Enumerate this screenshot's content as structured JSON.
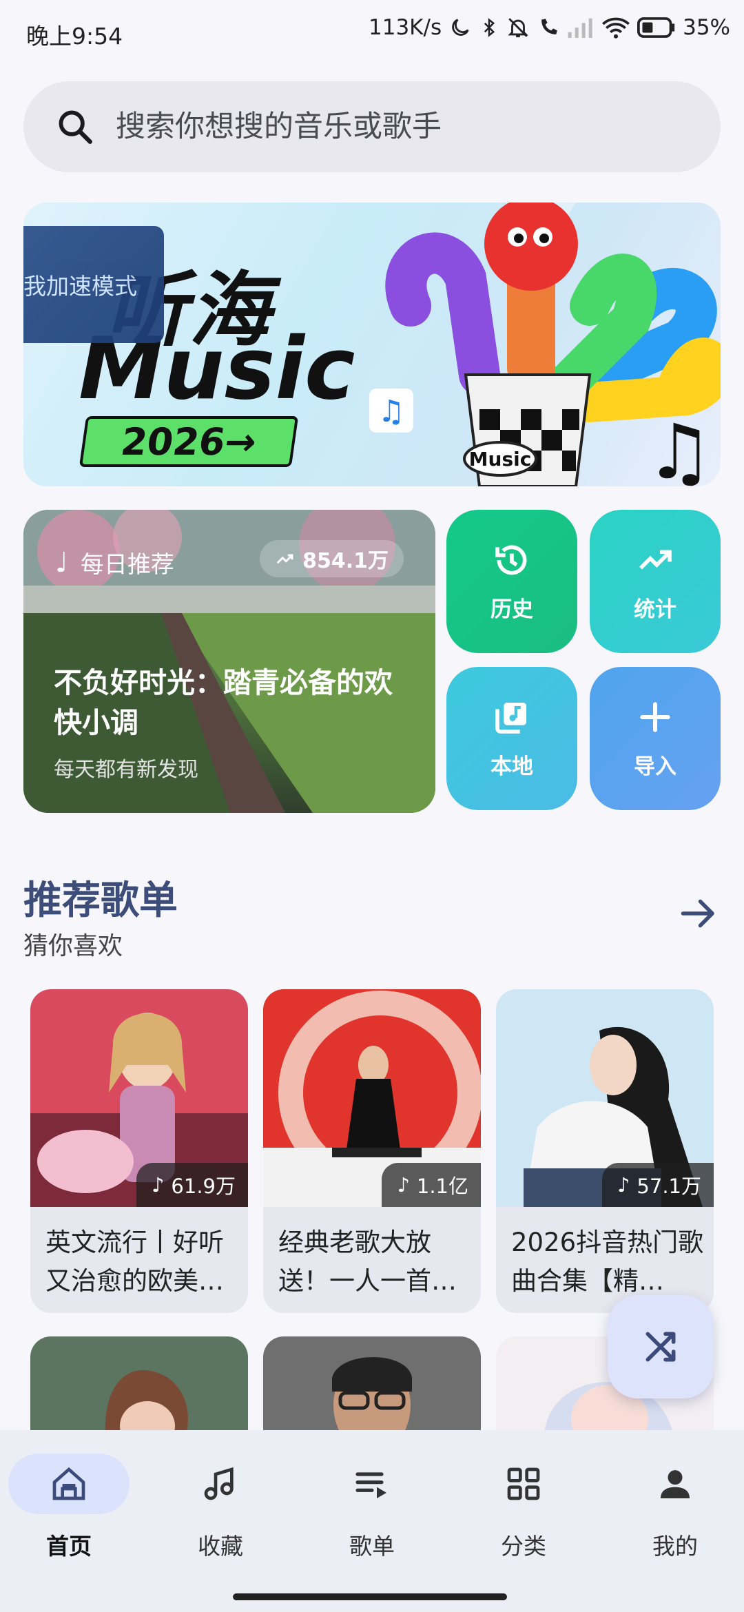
{
  "status_bar": {
    "time": "晚上9:54",
    "speed": "113K/s",
    "battery": "35%"
  },
  "search": {
    "placeholder": "搜索你想搜的音乐或歌手"
  },
  "banner": {
    "logo_line1": "听海",
    "logo_line2": "Music",
    "year_label": "2026→",
    "overlay_text": "我加速模式",
    "cup_text": "Music"
  },
  "daily": {
    "tag": "每日推荐",
    "play_count": "854.1万",
    "title": "不负好时光：踏青必备的欢快小调",
    "subtitle": "每天都有新发现"
  },
  "quick_actions": [
    {
      "label": "历史",
      "icon": "history-icon",
      "color": "#1bc586"
    },
    {
      "label": "统计",
      "icon": "trending-icon",
      "color": "#2fd3c4"
    },
    {
      "label": "本地",
      "icon": "local-music-icon",
      "color": "#44c4df"
    },
    {
      "label": "导入",
      "icon": "plus-icon",
      "color": "#5aa0ee"
    }
  ],
  "section": {
    "title": "推荐歌单",
    "subtitle": "猜你喜欢"
  },
  "playlists": [
    {
      "count": "61.9万",
      "name": "英文流行丨好听又治愈的欧美…"
    },
    {
      "count": "1.1亿",
      "name": "经典老歌大放送！一人一首…"
    },
    {
      "count": "57.1万",
      "name": "2026抖音热门歌曲合集【精…"
    }
  ],
  "nav": [
    {
      "label": "首页",
      "icon": "home-icon"
    },
    {
      "label": "收藏",
      "icon": "favorite-music-icon"
    },
    {
      "label": "歌单",
      "icon": "playlist-icon"
    },
    {
      "label": "分类",
      "icon": "category-icon"
    },
    {
      "label": "我的",
      "icon": "profile-icon"
    }
  ],
  "colors": {
    "accent": "#3d4d7a",
    "nav_bg": "#eceef6",
    "fab_bg": "#dde3fa"
  }
}
